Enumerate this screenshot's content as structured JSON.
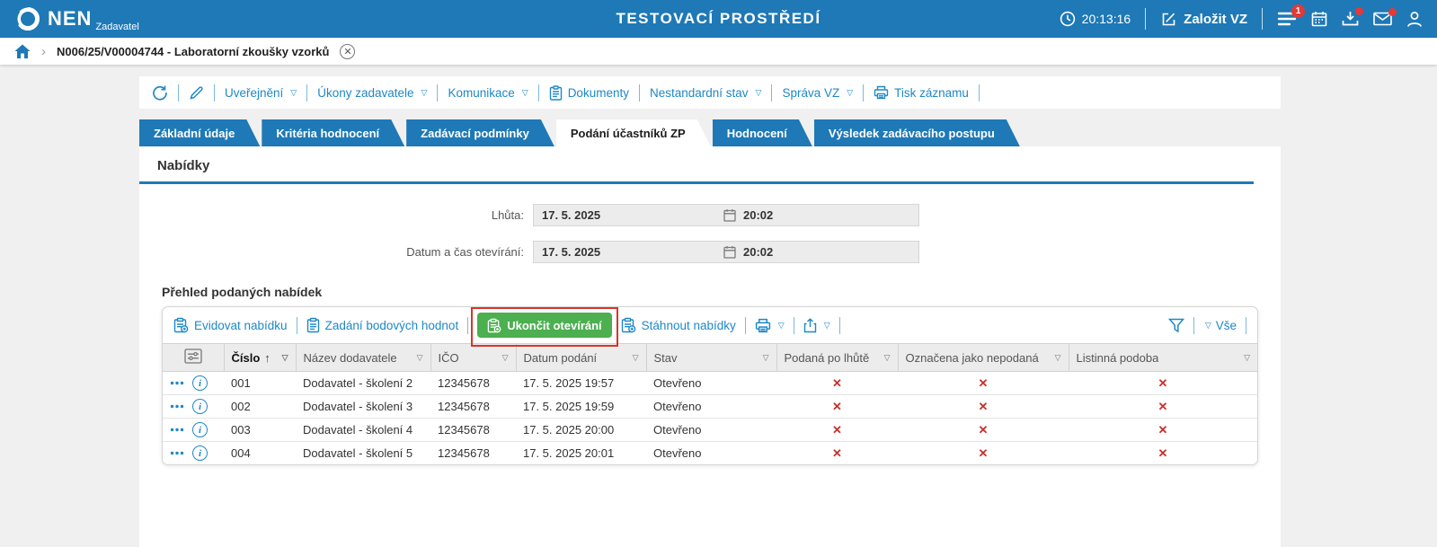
{
  "colors": {
    "header_blue": "#1e79b6",
    "link_blue": "#1e88c7",
    "action_green": "#4caf50",
    "cross_red": "#c9302c",
    "annotation_red": "#d9342b",
    "badge_red": "#e53935"
  },
  "icons": {
    "dropdown": "▽",
    "sort_asc": "↑",
    "cross": "✕",
    "chevron": "›",
    "close": "✕",
    "dots": "•••"
  },
  "header": {
    "logo": "NEN",
    "logo_sub": "Zadavatel",
    "title": "TESTOVACÍ PROSTŘEDÍ",
    "time": "20:13:16",
    "create_vz_label": "Založit VZ",
    "menu_badge": "1"
  },
  "breadcrumb": {
    "item": "N006/25/V00004744 - Laboratorní zkoušky vzorků"
  },
  "record_toolbar": {
    "items": [
      {
        "label": "Uveřejnění"
      },
      {
        "label": "Úkony zadavatele"
      },
      {
        "label": "Komunikace"
      },
      {
        "label": "Dokumenty"
      },
      {
        "label": "Nestandardní stav"
      },
      {
        "label": "Správa VZ"
      },
      {
        "label": "Tisk záznamu"
      }
    ]
  },
  "tabs": [
    {
      "label": "Základní údaje",
      "active": false
    },
    {
      "label": "Kritéria hodnocení",
      "active": false
    },
    {
      "label": "Zadávací podmínky",
      "active": false
    },
    {
      "label": "Podání účastníků ZP",
      "active": true
    },
    {
      "label": "Hodnocení",
      "active": false
    },
    {
      "label": "Výsledek zadávacího postupu",
      "active": false
    }
  ],
  "offers": {
    "section_title": "Nabídky"
  },
  "form": {
    "rows": [
      {
        "label": "Lhůta:",
        "date": "17. 5. 2025",
        "time": "20:02"
      },
      {
        "label": "Datum a čas otevírání:",
        "date": "17. 5. 2025",
        "time": "20:02"
      }
    ]
  },
  "overview": {
    "title": "Přehled podaných nabídek",
    "btn_evidovat": "Evidovat nabídku",
    "btn_body": "Zadání bodových hodnot",
    "btn_ukoncit": "Ukončit otevírání",
    "btn_stahnout": "Stáhnout nabídky",
    "all_label": "Vše"
  },
  "table": {
    "columns": [
      "Číslo",
      "Název dodavatele",
      "IČO",
      "Datum podání",
      "Stav",
      "Podaná po lhůtě",
      "Označena jako nepodaná",
      "Listinná podoba"
    ],
    "rows": [
      {
        "number": "001",
        "supplier": "Dodavatel - školení 2",
        "ico": "12345678",
        "submitted": "17. 5. 2025 19:57",
        "status": "Otevřeno"
      },
      {
        "number": "002",
        "supplier": "Dodavatel - školení 3",
        "ico": "12345678",
        "submitted": "17. 5. 2025 19:59",
        "status": "Otevřeno"
      },
      {
        "number": "003",
        "supplier": "Dodavatel - školení 4",
        "ico": "12345678",
        "submitted": "17. 5. 2025 20:00",
        "status": "Otevřeno"
      },
      {
        "number": "004",
        "supplier": "Dodavatel - školení 5",
        "ico": "12345678",
        "submitted": "17. 5. 2025 20:01",
        "status": "Otevřeno"
      }
    ]
  }
}
